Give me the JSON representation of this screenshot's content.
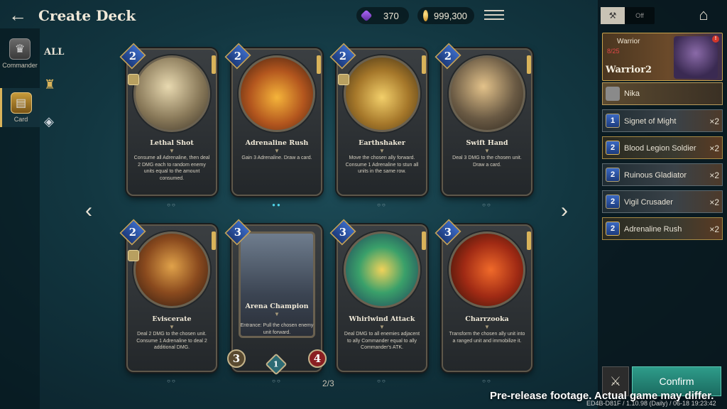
{
  "header": {
    "title": "Create Deck",
    "gems": "370",
    "gold": "999,300"
  },
  "sidebar": {
    "commander_label": "Commander",
    "card_label": "Card",
    "filter_all": "ALL"
  },
  "cards": [
    {
      "name": "Lethal Shot",
      "cost": "2",
      "text": "Consume all Adrenaline, then deal 2 DMG each to random enemy units equal to the amount consumed.",
      "dots": "○○"
    },
    {
      "name": "Adrenaline Rush",
      "cost": "2",
      "text": "Gain 3 Adrenaline. Draw a card.",
      "dots": "●●"
    },
    {
      "name": "Earthshaker",
      "cost": "2",
      "text": "Move the chosen ally forward. Consume 1 Adrenaline to stun all units in the same row.",
      "dots": "○○"
    },
    {
      "name": "Swift Hand",
      "cost": "2",
      "text": "Deal 3 DMG to the chosen unit. Draw a card.",
      "dots": "○○"
    },
    {
      "name": "Eviscerate",
      "cost": "2",
      "text": "Deal 2 DMG to the chosen unit. Consume 1 Adrenaline to deal 2 additional DMG.",
      "dots": "○○"
    },
    {
      "name": "Arena Champion",
      "cost": "3",
      "text": "Entrance: Pull the chosen enemy unit forward.",
      "dots": "○○",
      "atk": "3",
      "hp": "4",
      "mid": "1"
    },
    {
      "name": "Whirlwind Attack",
      "cost": "3",
      "text": "Deal DMG to all enemies adjacent to ally Commander equal to ally Commander's ATK.",
      "dots": "○○"
    },
    {
      "name": "Charrzooka",
      "cost": "3",
      "text": "Transform the chosen ally unit into a ranged unit and immobilize it.",
      "dots": "○○"
    }
  ],
  "pager": "2/3",
  "deck": {
    "toggle_label": "Off",
    "class": "Warrior",
    "count": "8/25",
    "alert": "!",
    "name": "Warrior2",
    "commander": "Nika",
    "items": [
      {
        "cost": "1",
        "name": "Signet of Might",
        "qty": "×2"
      },
      {
        "cost": "2",
        "name": "Blood Legion Soldier",
        "qty": "×2"
      },
      {
        "cost": "2",
        "name": "Ruinous Gladiator",
        "qty": "×2"
      },
      {
        "cost": "2",
        "name": "Vigil Crusader",
        "qty": "×2"
      },
      {
        "cost": "2",
        "name": "Adrenaline Rush",
        "qty": "×2"
      }
    ],
    "confirm_label": "Confirm"
  },
  "footer": {
    "note": "Pre-release footage. Actual game may differ.",
    "build": "ED4B-D81F / 1.10.98 (Daily) / 06-18 19:23:42"
  },
  "colors": {
    "accent_gold": "#d9b35a",
    "confirm_teal": "#2e9c8a",
    "cost_blue": "#3a69c4"
  }
}
